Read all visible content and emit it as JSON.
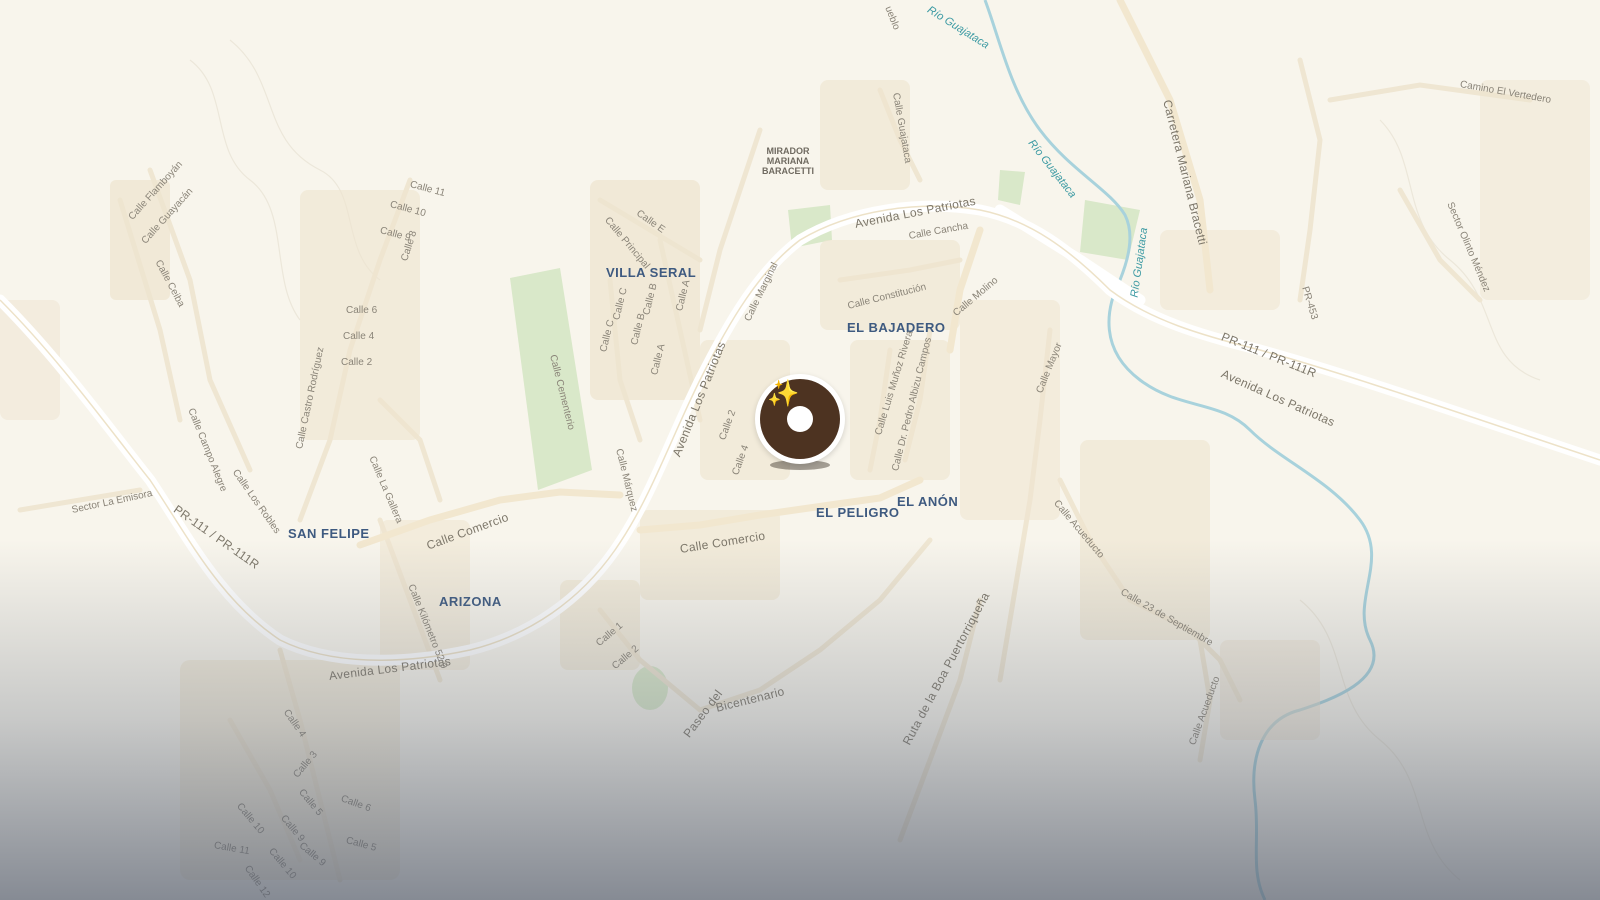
{
  "map": {
    "neighborhoods": {
      "villa_seral": "VILLA SERAL",
      "el_bajadero": "EL BAJADERO",
      "san_felipe": "SAN FELIPE",
      "arizona": "ARIZONA",
      "el_peligro": "EL PELIGRO",
      "el_anon": "EL ANÓN"
    },
    "poi": {
      "mirador": "MIRADOR MARIANA BARACETTI"
    },
    "roads": {
      "av_patriotas_top": "Avenida Los Patriotas",
      "av_patriotas_mid": "Avenida Los Patriotas",
      "av_patriotas_right": "Avenida Los Patriotas",
      "av_patriotas_bottom": "Avenida Los Patriotas",
      "carretera_mariana": "Carretera Mariana Bracetti",
      "pr111_right": "PR-111 / PR-111R",
      "pr111_left": "PR-111 / PR-111R",
      "calle_comercio_left": "Calle Comercio",
      "calle_comercio_right": "Calle Comercio",
      "paseo_bicentenario": "Paseo del Bicentenario",
      "ruta_boa": "Ruta de la Boa Puertorriqueña",
      "pr453": "PR-453",
      "camino_vertedero": "Camino El Vertedero",
      "sector_olinto": "Sector Olinto Méndez",
      "sector_emisora": "Sector La Emisora",
      "pueblo": "Pueblo"
    },
    "streets": {
      "calle_flamboyan": "Calle Flamboyán",
      "calle_guayacan": "Calle Guayacán",
      "calle_ceiba": "Calle Ceiba",
      "calle_11": "Calle 11",
      "calle_10": "Calle 10",
      "calle_9": "Calle 9",
      "calle_8": "Calle 8",
      "calle_6": "Calle 6",
      "calle_4": "Calle 4",
      "calle_2": "Calle 2",
      "calle_castro": "Calle Castro Rodríguez",
      "calle_campo": "Calle Campo Alegre",
      "calle_robles": "Calle Los Robles",
      "calle_gallera": "Calle La Gallera",
      "calle_cementerio": "Calle Cementerio",
      "calle_e": "Calle E",
      "calle_principal": "Calle Principal",
      "calle_c": "Calle C",
      "calle_c2": "Calle C",
      "calle_b": "Calle B",
      "calle_b2": "Calle B",
      "calle_a": "Calle A",
      "calle_a2": "Calle A",
      "calle_marginal": "Calle Marginal",
      "calle_guajataca": "Calle Guajataca",
      "calle_cancha": "Calle Cancha",
      "calle_constitucion": "Calle Constitución",
      "calle_molino": "Calle Molino",
      "calle_munoz": "Calle Luis Muñoz Rivera",
      "calle_albizu": "Calle Dr. Pedro Albizu Campos",
      "calle_mayor": "Calle Mayor",
      "calle_marquez": "Calle Márquez",
      "calle_2b": "Calle 2",
      "calle_4b": "Calle 4",
      "calle_acueducto": "Calle Acueducto",
      "calle_acueducto2": "Calle Acueducto",
      "calle_23sep": "Calle 23 de Septiembre",
      "calle_km": "Calle Kilómetro 52.9",
      "calle_1": "Calle 1",
      "calle_2c": "Calle 2",
      "sw_calle_4": "Calle 4",
      "sw_calle_3": "Calle 3",
      "sw_calle_5": "Calle 5",
      "sw_calle_6": "Calle 6",
      "sw_calle_10": "Calle 10",
      "sw_calle_9": "Calle 9",
      "sw_calle_11": "Calle 11",
      "sw_calle_10b": "Calle 10",
      "sw_calle_9b": "Calle 9",
      "sw_calle_5b": "Calle 5",
      "sw_calle_12": "Calle 12"
    },
    "rivers": {
      "rio_top": "Río Guajataca",
      "rio_mid": "Río Guajataca",
      "rio_right": "Río Guajataca"
    },
    "colors": {
      "land": "#f8f5ec",
      "major_road": "#ffffff",
      "park": "#d9e8c9",
      "river": "#a8d2dc",
      "marker": "#4d3321",
      "neighborhood_label": "#3e5a80"
    },
    "marker": {
      "icon": "sparkles-icon"
    }
  }
}
